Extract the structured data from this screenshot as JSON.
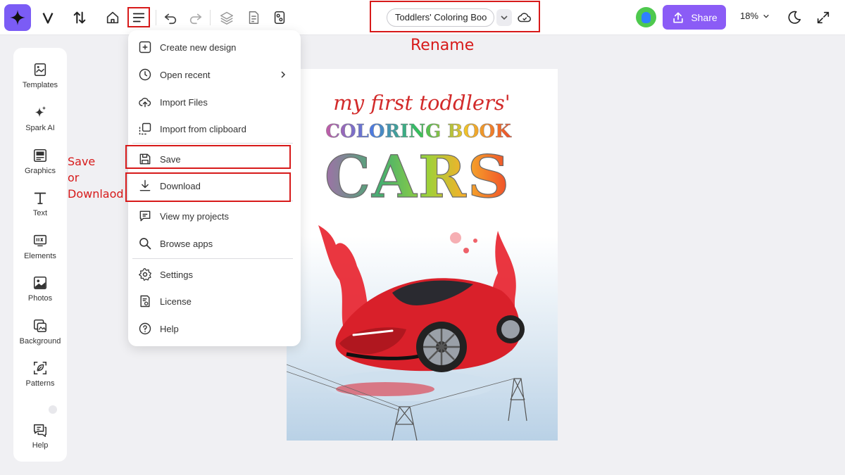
{
  "topbar": {
    "document_title": "Toddlers' Coloring Boo",
    "share_label": "Share",
    "zoom_label": "18%"
  },
  "annotations": {
    "rename": "Rename",
    "save_line1": "Save",
    "save_line2": "or",
    "save_line3": "Downlaod"
  },
  "sidebar": {
    "items": [
      {
        "label": "Templates",
        "icon": "templates-icon"
      },
      {
        "label": "Spark AI",
        "icon": "sparkle-icon"
      },
      {
        "label": "Graphics",
        "icon": "graphics-icon"
      },
      {
        "label": "Text",
        "icon": "text-icon"
      },
      {
        "label": "Elements",
        "icon": "elements-icon"
      },
      {
        "label": "Photos",
        "icon": "photos-icon"
      },
      {
        "label": "Background",
        "icon": "background-icon"
      },
      {
        "label": "Patterns",
        "icon": "patterns-icon"
      },
      {
        "label": "Help",
        "icon": "help-chat-icon"
      }
    ]
  },
  "menu": {
    "items": [
      {
        "label": "Create new design",
        "icon": "new-file-icon"
      },
      {
        "label": "Open recent",
        "icon": "clock-icon"
      },
      {
        "label": "Import Files",
        "icon": "cloud-upload-icon"
      },
      {
        "label": "Import from clipboard",
        "icon": "clipboard-icon"
      },
      {
        "label": "Save",
        "icon": "save-icon"
      },
      {
        "label": "Download",
        "icon": "download-icon"
      },
      {
        "label": "View my projects",
        "icon": "projects-icon"
      },
      {
        "label": "Browse apps",
        "icon": "search-icon"
      },
      {
        "label": "Settings",
        "icon": "gear-icon"
      },
      {
        "label": "License",
        "icon": "license-icon"
      },
      {
        "label": "Help",
        "icon": "help-icon"
      }
    ]
  },
  "poster": {
    "line1": "my first toddlers'",
    "line2": "COLORING BOOK",
    "line3": "CARS"
  },
  "colors": {
    "brand": "#7b5cf5",
    "share": "#8b5cf6",
    "annotation": "#d71a1a"
  }
}
